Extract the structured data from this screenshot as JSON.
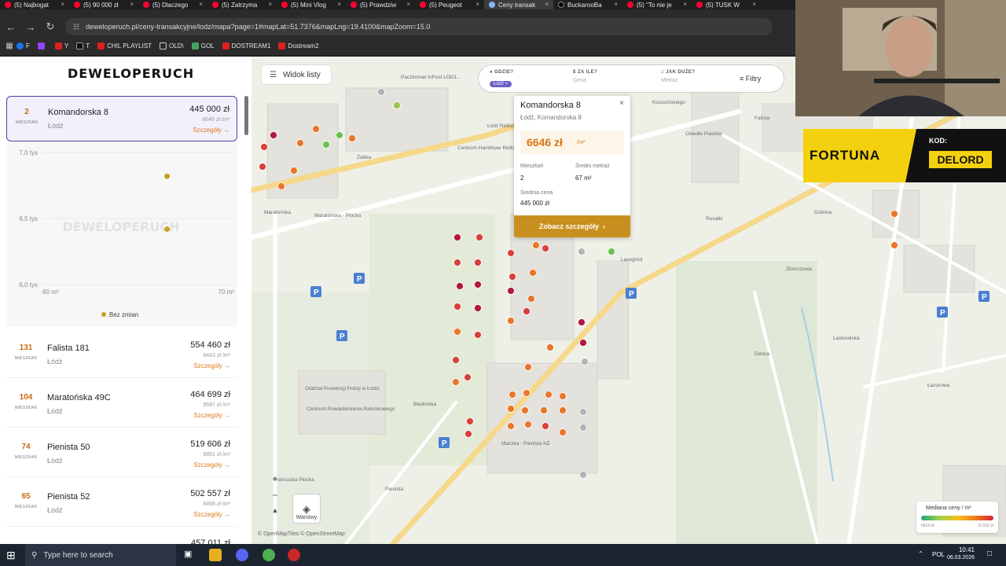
{
  "browser": {
    "tabs": [
      {
        "label": "(5) Najbogat",
        "icon": "youtube-icon"
      },
      {
        "label": "(5) 90 000 zł",
        "icon": "youtube-icon"
      },
      {
        "label": "(5) Dlaczego",
        "icon": "youtube-icon"
      },
      {
        "label": "(5) Zatrzyma",
        "icon": "youtube-icon"
      },
      {
        "label": "(5) Mini Vlog",
        "icon": "youtube-icon"
      },
      {
        "label": "(5) Prawdziw",
        "icon": "youtube-icon"
      },
      {
        "label": "(5) Peugeot",
        "icon": "youtube-icon"
      },
      {
        "label": "Ceny transak",
        "icon": "globe-icon",
        "active": true
      },
      {
        "label": "BuckarooBa",
        "icon": "x-icon"
      },
      {
        "label": "(5) \"To nie je",
        "icon": "youtube-icon"
      },
      {
        "label": "(5) TUSK W",
        "icon": "youtube-icon"
      }
    ],
    "url": "deweloperuch.pl/ceny-transakcyjne/lodz/mapa?page=1#mapLat=51.7376&mapLng=19.4100&mapZoom=15.0",
    "bookmarks": [
      {
        "label": "F",
        "icon": "facebook-icon"
      },
      {
        "label": "",
        "icon": "twitch-icon"
      },
      {
        "label": "Y",
        "icon": "youtube-icon"
      },
      {
        "label": "T",
        "icon": "x-icon"
      },
      {
        "label": "CHIL PLAYLIST",
        "icon": "youtube-icon"
      },
      {
        "label": "OLD\\",
        "icon": "folder-icon"
      },
      {
        "label": "GOL",
        "icon": "gol-icon"
      },
      {
        "label": "DOSTREAM1",
        "icon": "youtube-icon"
      },
      {
        "label": "Dostream2",
        "icon": "youtube-icon"
      }
    ]
  },
  "sidebar": {
    "logo": "DEWELOPERUCH",
    "listings": [
      {
        "count": "2",
        "unit": "MIESZKAŃ",
        "name": "Komandorska 8",
        "city": "Łódź",
        "price": "445 000 zł",
        "ppm": "6646 zł /m²",
        "link": "Szczegóły →",
        "selected": true
      },
      {
        "count": "131",
        "unit": "MIESZKAŃ",
        "name": "Falista 181",
        "city": "Łódź",
        "price": "554 460 zł",
        "ppm": "8443 zł /m²",
        "link": "Szczegóły →"
      },
      {
        "count": "104",
        "unit": "MIESZKAŃ",
        "name": "Maratońska 49C",
        "city": "Łódź",
        "price": "464 699 zł",
        "ppm": "9597 zł /m²",
        "link": "Szczegóły →"
      },
      {
        "count": "74",
        "unit": "MIESZKAŃ",
        "name": "Pienista 50",
        "city": "Łódź",
        "price": "519 606 zł",
        "ppm": "8851 zł /m²",
        "link": "Szczegóły →"
      },
      {
        "count": "65",
        "unit": "MIESZKAŃ",
        "name": "Pienista 52",
        "city": "Łódź",
        "price": "502 557 zł",
        "ppm": "8468 zł /m²",
        "link": "Szczegóły →"
      },
      {
        "count": "",
        "unit": "",
        "name": "",
        "city": "",
        "price": "457 011 zł",
        "ppm": "",
        "link": ""
      }
    ]
  },
  "chart_data": {
    "type": "scatter",
    "title": "",
    "xlabel": "",
    "ylabel": "",
    "x_ticks": [
      "60 m²",
      "70 m²"
    ],
    "y_ticks": [
      "7,0 tys",
      "6,5 tys",
      "6,0 tys"
    ],
    "xlim": [
      60,
      70
    ],
    "ylim": [
      6000,
      7000
    ],
    "series": [
      {
        "name": "Bez zmian",
        "color": "#c8a21e",
        "x": [
          66.5,
          66.5
        ],
        "y": [
          6820,
          6420
        ]
      }
    ],
    "watermark": "DEWELOPERUCH",
    "legend_position": "bottom"
  },
  "map": {
    "list_button": "Widok listy",
    "search": {
      "where_label": "GDZIE?",
      "where_chip": "Łódź",
      "price_label": "ZA ILE?",
      "price_placeholder": "Cena",
      "size_label": "JAK DUŻE?",
      "size_placeholder": "Metraż",
      "filters": "Filtry"
    },
    "popup": {
      "title": "Komandorska 8",
      "subtitle": "Łódź, Komandorska 8",
      "price": "6646 zł",
      "price_unit": "/m²",
      "flats_label": "Mieszkań",
      "flats_value": "2",
      "avg_area_label": "Średni metraż",
      "avg_area_value": "67 m²",
      "avg_price_label": "Średnia cena",
      "avg_price_value": "445 000 zł",
      "button": "Zobacz szczegóły"
    },
    "layers_label": "Warstwy",
    "attribution": "© OpenMapTiles © OpenStreetMap",
    "legend": {
      "title": "Mediana ceny / m²",
      "min": "6514 zł",
      "max": "11 032 zł"
    },
    "labels": [
      "Paczkomat InPost LOD1...",
      "Łódź Retkinia",
      "Centrum Handlowe Retkinia (Hala 2)",
      "Żabka",
      "Maratońska",
      "Maratońska - Plocka",
      "Osiedle Piastów",
      "Kusocińskiego",
      "Falista",
      "Rusałki",
      "Zbocczowa",
      "Dolinna",
      "Lasogród",
      "Laskowicka",
      "Łazurowa",
      "Francuska Płocka",
      "Pienista",
      "Biedronka",
      "Maczka - Pienista NŻ",
      "Oddział Prewencji Policji w Łodzi",
      "Centrum Powiadamiania Ratunkowego",
      "Denna"
    ]
  },
  "ad": {
    "brand": "FORTUNA",
    "code_label": "KOD:",
    "code": "DELORD"
  },
  "taskbar": {
    "search_placeholder": "Type here to search",
    "lang": "POL",
    "time": "10:41",
    "date": "06.03.2026"
  }
}
